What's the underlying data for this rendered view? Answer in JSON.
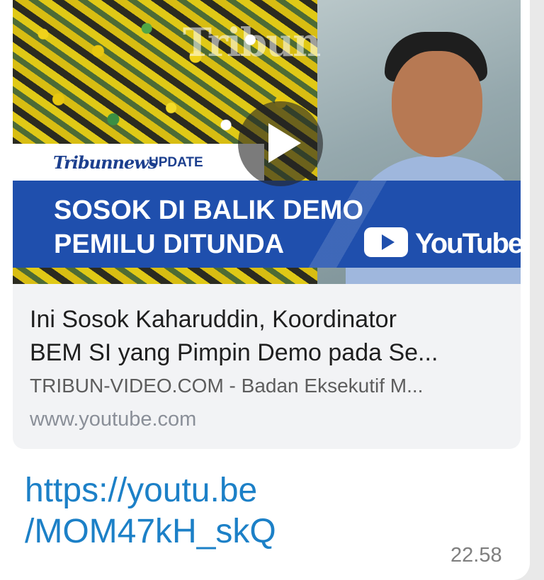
{
  "preview": {
    "thumbnail": {
      "watermark": "Tribun",
      "brand_logo": "Tribunnews",
      "update_label": "UPDATE",
      "headline_lines": [
        "SOSOK DI BALIK DEMO",
        "PEMILU DITUNDA"
      ],
      "platform_label": "YouTube"
    },
    "title_lines": [
      "Ini Sosok Kaharuddin, Koordinator",
      "BEM SI yang Pimpin Demo pada Se..."
    ],
    "description": "TRIBUN-VIDEO.COM - Badan Eksekutif M...",
    "domain": "www.youtube.com"
  },
  "message": {
    "link_lines": [
      "https://youtu.be",
      "/MOM47kH_skQ"
    ],
    "time": "22.58"
  },
  "colors": {
    "link": "#1c80c7",
    "headline_band": "#1f4fad",
    "card_background": "#f2f3f5"
  }
}
